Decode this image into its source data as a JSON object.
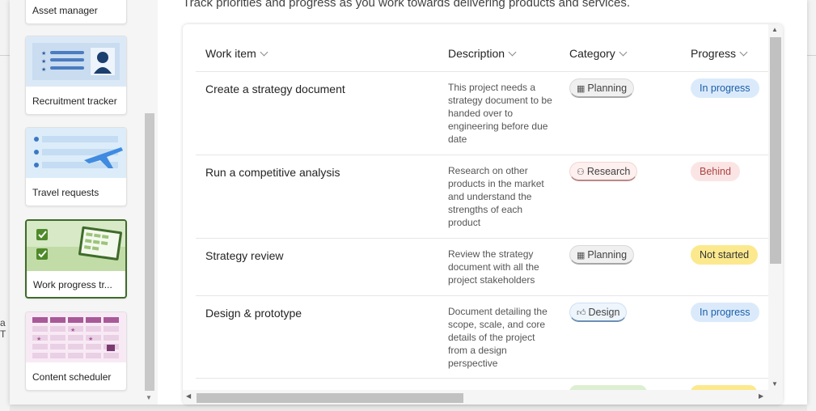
{
  "background": {
    "left_fragment": "a T"
  },
  "sidebar": {
    "templates": [
      {
        "label": "Asset manager",
        "selected": false
      },
      {
        "label": "Recruitment tracker",
        "selected": false
      },
      {
        "label": "Travel requests",
        "selected": false
      },
      {
        "label": "Work progress tr...",
        "selected": true
      },
      {
        "label": "Content scheduler",
        "selected": false
      }
    ]
  },
  "main": {
    "subtitle": "Track priorities and progress as you work towards delivering products and services."
  },
  "table": {
    "columns": [
      "Work item",
      "Description",
      "Category",
      "Progress"
    ],
    "rows": [
      {
        "title": "Create a strategy document",
        "description": "This project needs a strategy document to be handed over to engineering before due date",
        "category": "Planning",
        "category_icon": "calendar-icon",
        "progress": "In progress"
      },
      {
        "title": "Run a competitive analysis",
        "description": "Research on other products in the market and understand the strengths of each product",
        "category": "Research",
        "category_icon": "people-icon",
        "progress": "Behind"
      },
      {
        "title": "Strategy review",
        "description": "Review the strategy document with all the project stakeholders",
        "category": "Planning",
        "category_icon": "calendar-icon",
        "progress": "Not started"
      },
      {
        "title": "Design & prototype",
        "description": "Document detailing the scope, scale, and core details of the project from a design perspective",
        "category": "Design",
        "category_icon": "thumbs-up-icon",
        "progress": "In progress"
      }
    ]
  },
  "colors": {
    "accent_selected": "#3f6b2a",
    "in_progress_bg": "#dbeafb",
    "behind_bg": "#fbe5e4",
    "not_started_bg": "#fce98e"
  }
}
